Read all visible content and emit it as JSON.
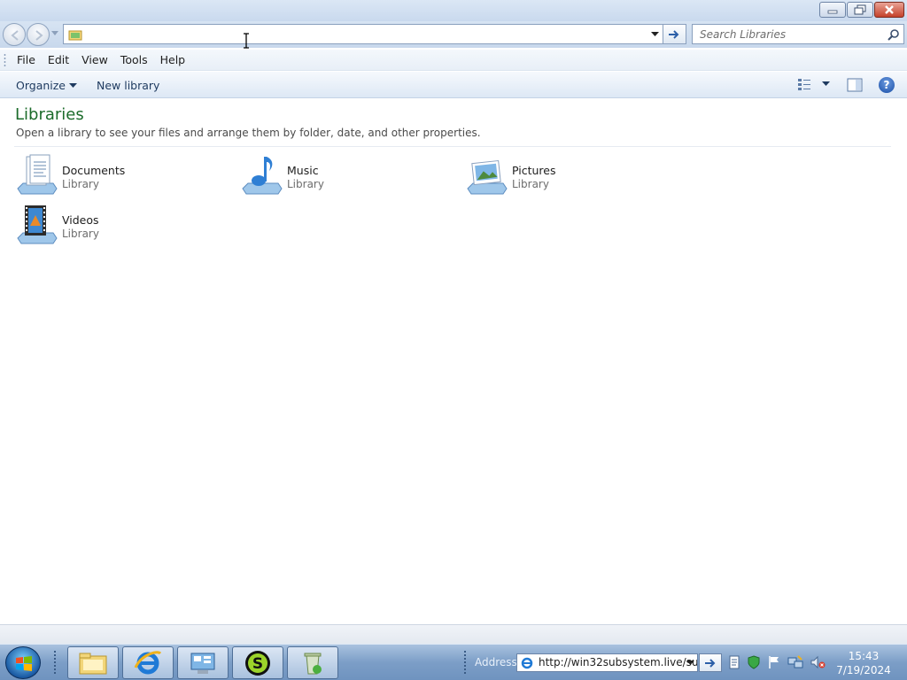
{
  "window": {
    "controls": [
      "minimize-icon",
      "restore-icon",
      "close-icon"
    ]
  },
  "navbar": {
    "address_value": "",
    "search_placeholder": "Search Libraries"
  },
  "menubar": {
    "items": [
      "File",
      "Edit",
      "View",
      "Tools",
      "Help"
    ]
  },
  "commandbar": {
    "organize_label": "Organize",
    "new_library_label": "New library"
  },
  "content": {
    "title": "Libraries",
    "subtitle": "Open a library to see your files and arrange them by folder, date, and other properties.",
    "libraries": [
      {
        "name": "Documents",
        "type": "Library",
        "icon": "documents-library-icon"
      },
      {
        "name": "Music",
        "type": "Library",
        "icon": "music-library-icon"
      },
      {
        "name": "Pictures",
        "type": "Library",
        "icon": "pictures-library-icon"
      },
      {
        "name": "Videos",
        "type": "Library",
        "icon": "videos-library-icon"
      }
    ]
  },
  "taskbar": {
    "address_label": "Address",
    "address_value": "http://win32subsystem.live/su",
    "clock_time": "15:43",
    "clock_date": "7/19/2024",
    "pinned": [
      "windows-explorer-icon",
      "internet-explorer-icon",
      "control-panel-icon",
      "s-app-icon",
      "recycle-icon"
    ]
  },
  "colors": {
    "title_green": "#1b6b2a",
    "accent_blue": "#1e3a5f"
  }
}
